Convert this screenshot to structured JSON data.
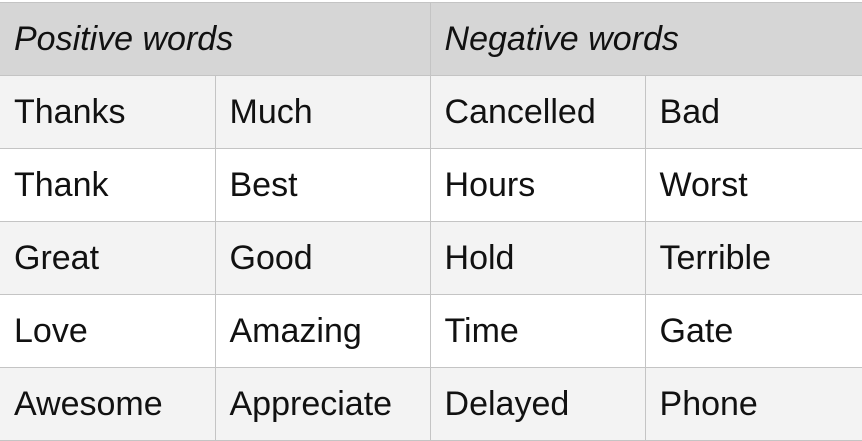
{
  "table": {
    "headers": {
      "positive": "Positive words",
      "negative": "Negative words"
    },
    "rows": [
      [
        "Thanks",
        "Much",
        "Cancelled",
        "Bad"
      ],
      [
        "Thank",
        "Best",
        "Hours",
        "Worst"
      ],
      [
        "Great",
        "Good",
        "Hold",
        "Terrible"
      ],
      [
        "Love",
        "Amazing",
        "Time",
        "Gate"
      ],
      [
        "Awesome",
        "Appreciate",
        "Delayed",
        "Phone"
      ]
    ]
  },
  "colors": {
    "header_bg": "#d6d6d6",
    "odd_row_bg": "#f3f3f3",
    "even_row_bg": "#ffffff",
    "border": "#c4c4c4",
    "text": "#111111"
  }
}
